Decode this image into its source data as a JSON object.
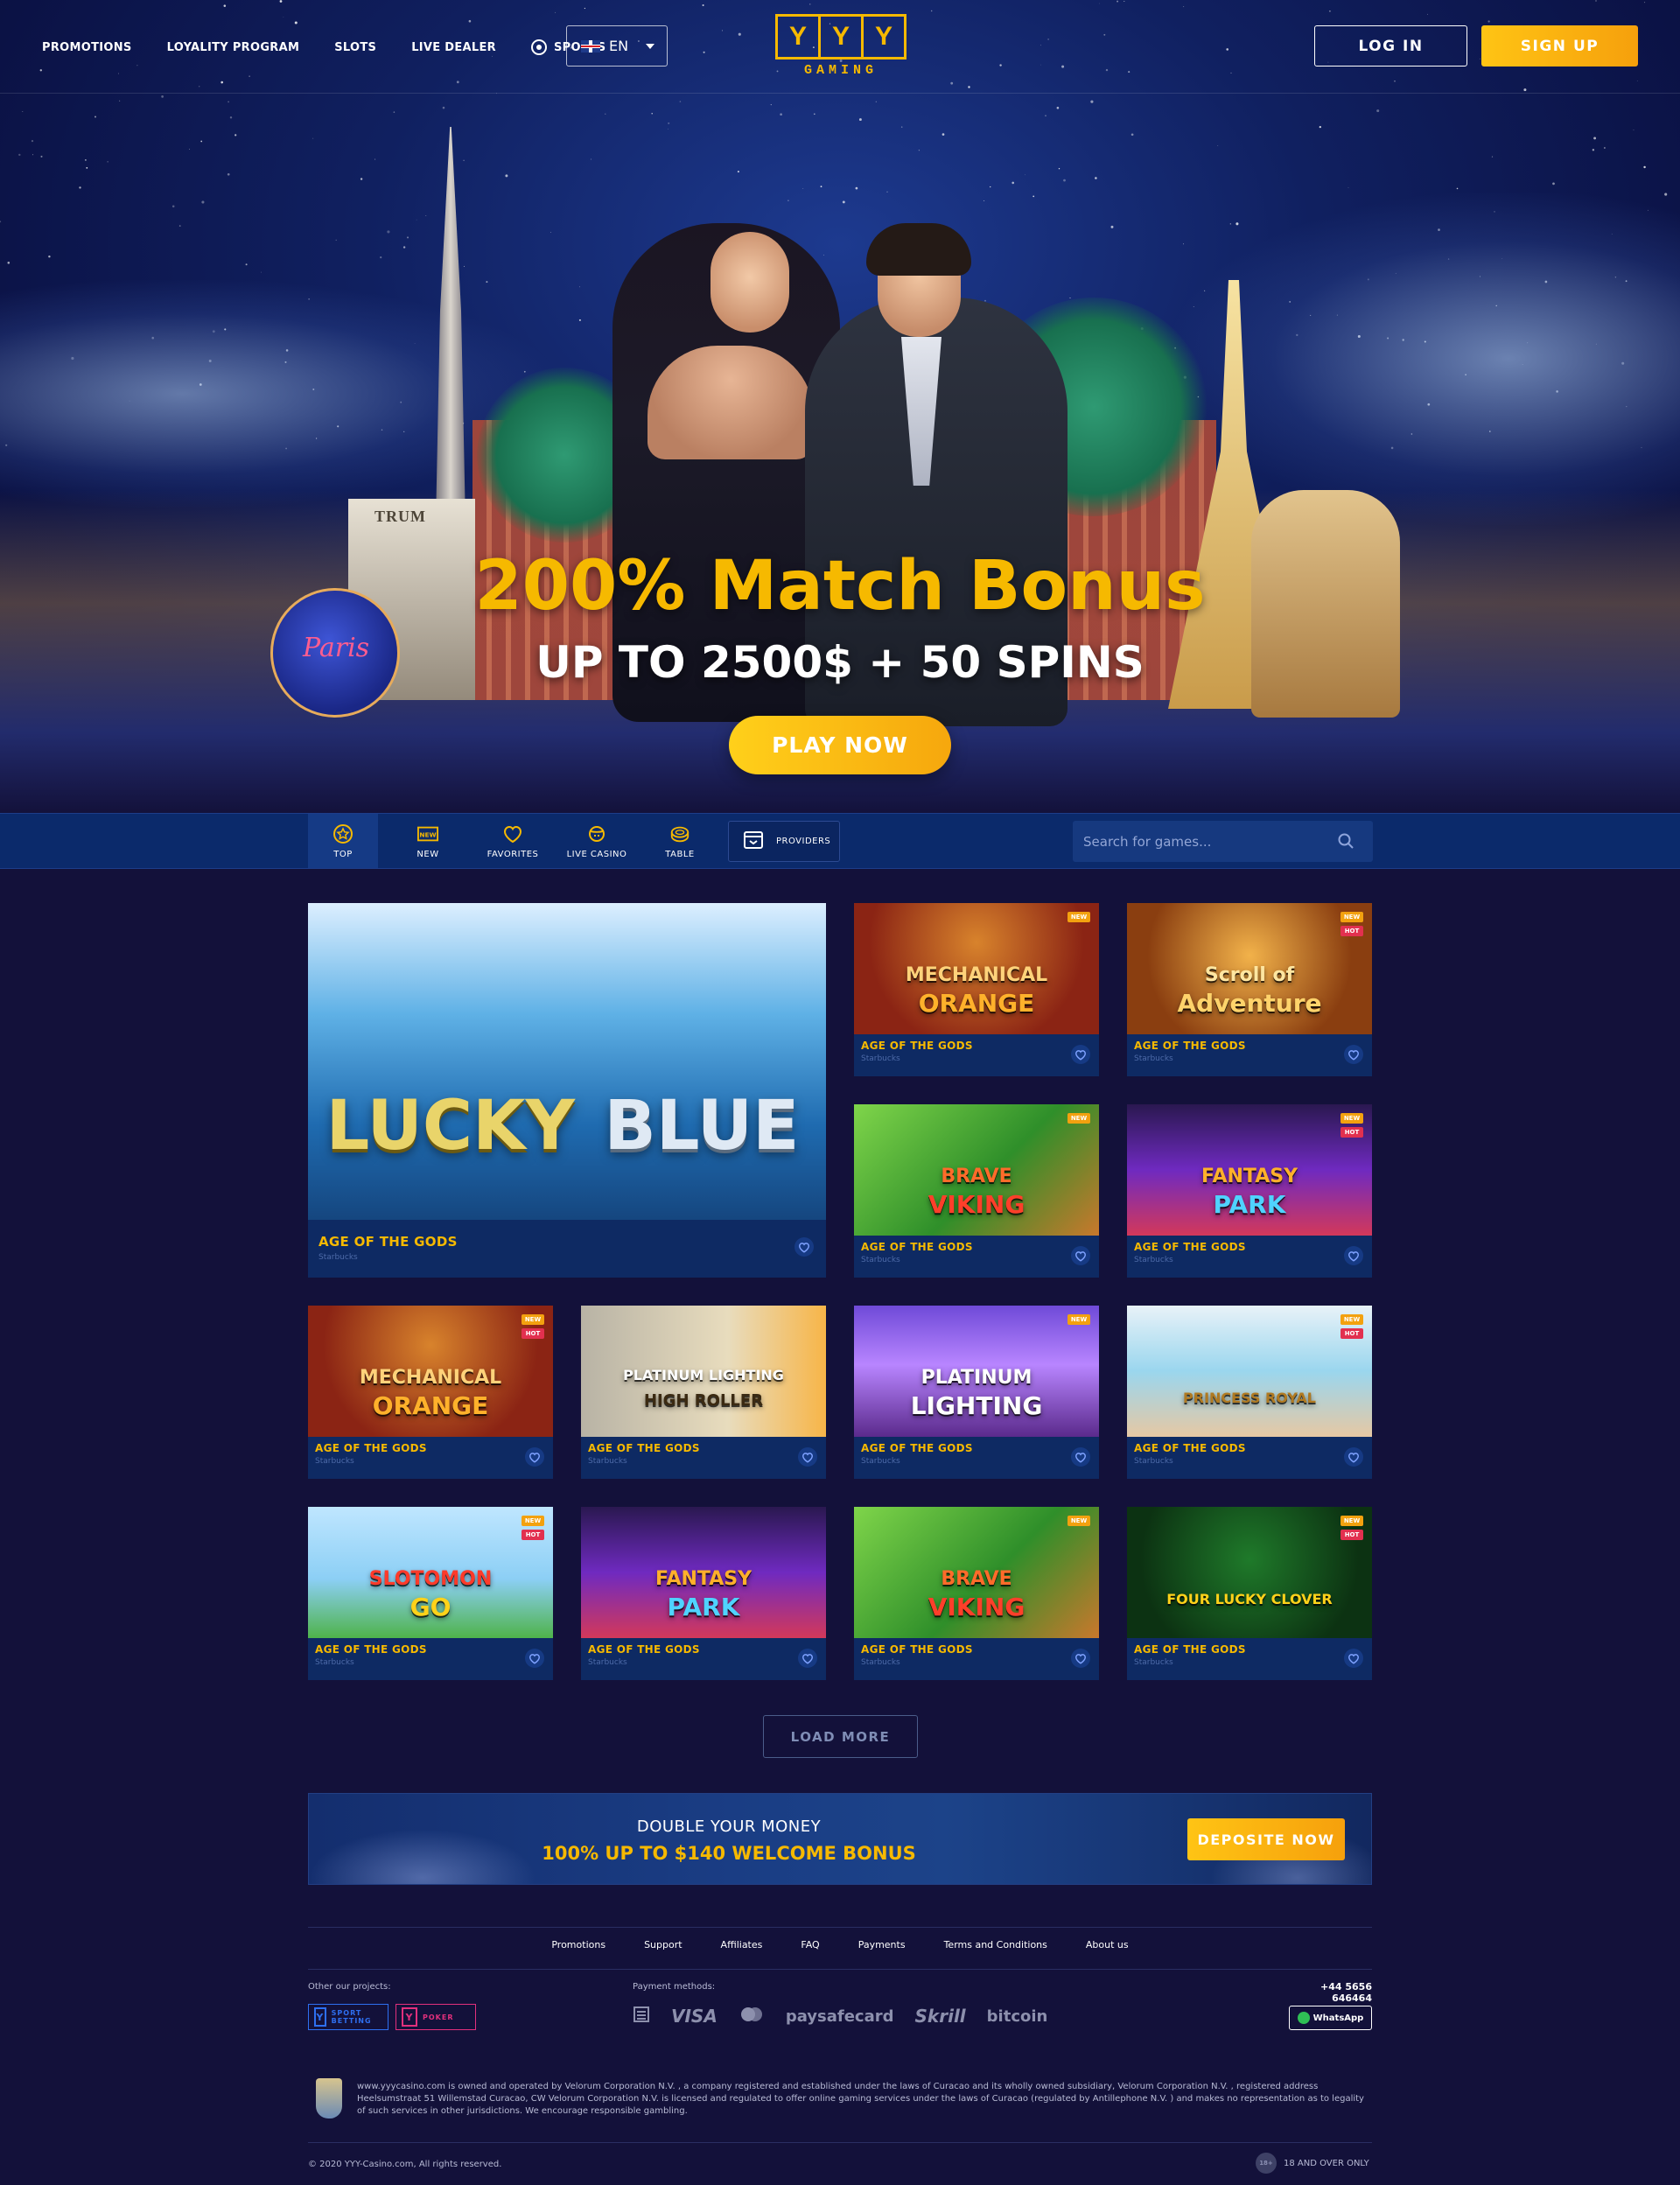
{
  "header": {
    "nav": [
      "PROMOTIONS",
      "LOYALITY PROGRAM",
      "SLOTS",
      "LIVE DEALER",
      "SPORTS"
    ],
    "language": "EN",
    "logo_letters": [
      "Y",
      "Y",
      "Y"
    ],
    "logo_text": "GAMING",
    "login_label": "LOG IN",
    "signup_label": "SIGN UP"
  },
  "hero": {
    "title": "200% Match Bonus",
    "subtitle": "UP TO 2500$ + 50 SPINS",
    "cta": "PLAY NOW",
    "building_sign": "TRUM",
    "balloon_text": "Paris"
  },
  "categories": {
    "items": [
      {
        "label": "TOP",
        "icon": "star-icon"
      },
      {
        "label": "NEW",
        "icon": "new-tag-icon"
      },
      {
        "label": "FAVORITES",
        "icon": "heart-icon"
      },
      {
        "label": "LIVE CASINO",
        "icon": "dealer-icon"
      },
      {
        "label": "TABLE",
        "icon": "chips-icon"
      }
    ],
    "providers_label": "PROVIDERS",
    "search_placeholder": "Search for games..."
  },
  "games": [
    {
      "art_line1": "LUCKY",
      "art_line2": "BLUE",
      "title": "AGE OF THE GODS",
      "provider": "Starbucks",
      "badges": []
    },
    {
      "art_line1": "MECHANICAL",
      "art_line2": "ORANGE",
      "title": "AGE OF THE GODS",
      "provider": "Starbucks",
      "badges": [
        "NEW"
      ]
    },
    {
      "art_line1": "Scroll of",
      "art_line2": "Adventure",
      "title": "AGE OF THE GODS",
      "provider": "Starbucks",
      "badges": [
        "NEW",
        "HOT"
      ]
    },
    {
      "art_line1": "BRAVE",
      "art_line2": "VIKING",
      "title": "AGE OF THE GODS",
      "provider": "Starbucks",
      "badges": [
        "NEW"
      ]
    },
    {
      "art_line1": "FANTASY",
      "art_line2": "PARK",
      "title": "AGE OF THE GODS",
      "provider": "Starbucks",
      "badges": [
        "NEW",
        "HOT"
      ]
    },
    {
      "art_line1": "MECHANICAL",
      "art_line2": "ORANGE",
      "title": "AGE OF THE GODS",
      "provider": "Starbucks",
      "badges": [
        "NEW",
        "HOT"
      ]
    },
    {
      "art_line1": "PLATINUM LIGHTING",
      "art_line2": "HIGH ROLLER",
      "title": "AGE OF THE GODS",
      "provider": "Starbucks",
      "badges": []
    },
    {
      "art_line1": "PLATINUM",
      "art_line2": "LIGHTING",
      "title": "AGE OF THE GODS",
      "provider": "Starbucks",
      "badges": [
        "NEW"
      ]
    },
    {
      "art_line1": "PRINCESS ROYAL",
      "art_line2": "",
      "title": "AGE OF THE GODS",
      "provider": "Starbucks",
      "badges": [
        "NEW",
        "HOT"
      ]
    },
    {
      "art_line1": "SLOTOMON",
      "art_line2": "GO",
      "title": "AGE OF THE GODS",
      "provider": "Starbucks",
      "badges": [
        "NEW",
        "HOT"
      ]
    },
    {
      "art_line1": "FANTASY",
      "art_line2": "PARK",
      "title": "AGE OF THE GODS",
      "provider": "Starbucks",
      "badges": []
    },
    {
      "art_line1": "BRAVE",
      "art_line2": "VIKING",
      "title": "AGE OF THE GODS",
      "provider": "Starbucks",
      "badges": [
        "NEW"
      ]
    },
    {
      "art_line1": "FOUR LUCKY CLOVER",
      "art_line2": "",
      "title": "AGE OF THE GODS",
      "provider": "Starbucks",
      "badges": [
        "NEW",
        "HOT"
      ]
    }
  ],
  "load_more": "LOAD MORE",
  "promo": {
    "line1": "DOUBLE YOUR MONEY",
    "line2": "100% UP TO $140 WELCOME BONUS",
    "cta": "DEPOSITE NOW"
  },
  "footer": {
    "links": [
      "Promotions",
      "Support",
      "Affiliates",
      "FAQ",
      "Payments",
      "Terms and Conditions",
      "About us"
    ],
    "other_projects_label": "Other our projects:",
    "projects": [
      {
        "label": "SPORT BETTING",
        "letter": "Y"
      },
      {
        "label": "POKER",
        "letter": "Y"
      }
    ],
    "payment_label": "Payment methods:",
    "payments": [
      "VISA",
      "paysafecard",
      "Skrill",
      "bitcoin"
    ],
    "phone": "+44 5656 646464",
    "whatsapp": "WhatsApp",
    "legal": "www.yyycasino.com is owned and operated by Velorum Corporation N.V. , a company registered and established under the laws of Curacao and its wholly owned subsidiary, Velorum Corporation N.V. , registered address Heelsumstraat 51 Willemstad Curacao, CW Velorum Corporation N.V. is licensed and regulated to offer online gaming services under the laws of Curacao (regulated by Antillephone N.V. ) and makes no representation as to legality of such services in other jurisdictions. We encourage responsible gambling.",
    "copyright": "© 2020 YYY-Casino.com, All rights reserved.",
    "age_badge": "18+",
    "age_text": "18 AND OVER ONLY"
  },
  "colors": {
    "accent": "#f6b900",
    "background": "#13113a",
    "card": "#0e2a63",
    "new_badge": "#f3a10f",
    "hot_badge": "#e2304f"
  }
}
